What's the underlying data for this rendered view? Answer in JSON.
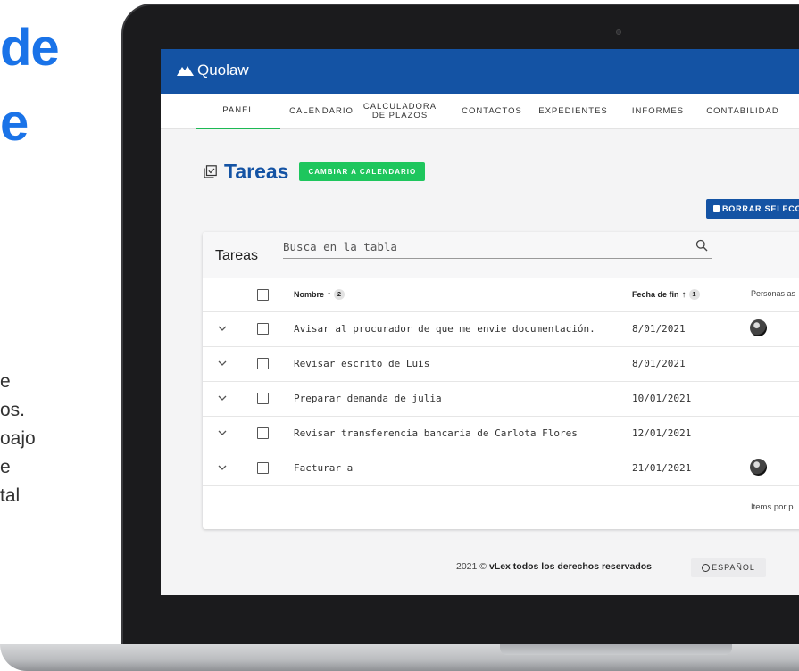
{
  "hero": {
    "line1": "de",
    "line2": "e"
  },
  "side_text": [
    "e",
    "os.",
    "oajo",
    "e",
    "tal"
  ],
  "app": {
    "brand": "Quolaw",
    "nav": [
      {
        "label": "PANEL",
        "active": true
      },
      {
        "label": "CALENDARIO",
        "active": false
      },
      {
        "label": "CALCULADORA DE PLAZOS",
        "active": false
      },
      {
        "label": "CONTACTOS",
        "active": false
      },
      {
        "label": "EXPEDIENTES",
        "active": false
      },
      {
        "label": "INFORMES",
        "active": false
      },
      {
        "label": "CONTABILIDAD",
        "active": false
      }
    ],
    "page_title": "Tareas",
    "calendar_button": "CAMBIAR A CALENDARIO",
    "delete_button": "BORRAR SELECC",
    "table": {
      "title": "Tareas",
      "search_placeholder": "Busca en la tabla",
      "columns": {
        "name": "Nombre",
        "name_sort": "2",
        "end_date": "Fecha de fin",
        "end_date_sort": "1",
        "people": "Personas as"
      },
      "rows": [
        {
          "name": "Avisar al procurador de que me envie documentación.",
          "end_date": "8/01/2021",
          "has_avatar": true
        },
        {
          "name": "Revisar escrito de Luis",
          "end_date": "8/01/2021",
          "has_avatar": false
        },
        {
          "name": "Preparar demanda de julia",
          "end_date": "10/01/2021",
          "has_avatar": false
        },
        {
          "name": "Revisar transferencia bancaria de Carlota Flores",
          "end_date": "12/01/2021",
          "has_avatar": false
        },
        {
          "name": "Facturar a",
          "end_date": "21/01/2021",
          "has_avatar": true
        }
      ],
      "items_per_page_label": "Items por p"
    },
    "footer": {
      "year": "2021 ©",
      "rights": "vLex todos los derechos reservados",
      "language": "ESPAÑOL"
    }
  },
  "colors": {
    "brand_blue": "#1453a4",
    "accent_green": "#1ec65d",
    "hero_blue": "#1a73e8"
  }
}
